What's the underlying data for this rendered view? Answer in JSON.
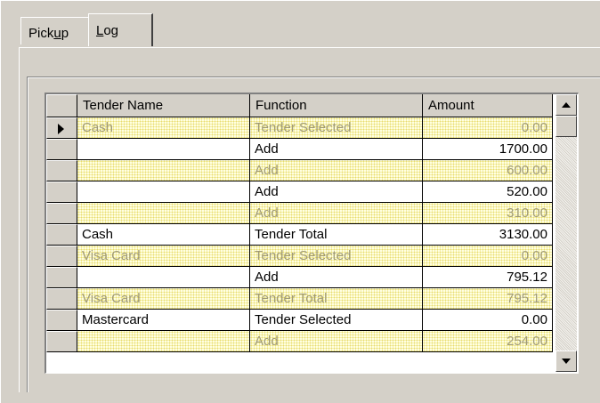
{
  "tabs": [
    {
      "label_pre": "Pick",
      "label_u": "u",
      "label_post": "p"
    },
    {
      "label_pre": "",
      "label_u": "L",
      "label_post": "og"
    }
  ],
  "grid": {
    "columns": [
      "Tender Name",
      "Function",
      "Amount"
    ],
    "rows": [
      {
        "tender": "Cash",
        "function": "Tender Selected",
        "amount": "0.00"
      },
      {
        "tender": "",
        "function": "Add",
        "amount": "1700.00"
      },
      {
        "tender": "",
        "function": "Add",
        "amount": "600.00"
      },
      {
        "tender": "",
        "function": "Add",
        "amount": "520.00"
      },
      {
        "tender": "",
        "function": "Add",
        "amount": "310.00"
      },
      {
        "tender": "Cash",
        "function": "Tender Total",
        "amount": "3130.00"
      },
      {
        "tender": "Visa Card",
        "function": "Tender Selected",
        "amount": "0.00"
      },
      {
        "tender": "",
        "function": "Add",
        "amount": "795.12"
      },
      {
        "tender": "Visa Card",
        "function": "Tender Total",
        "amount": "795.12"
      },
      {
        "tender": "Mastercard",
        "function": "Tender Selected",
        "amount": "0.00"
      },
      {
        "tender": "",
        "function": "Add",
        "amount": "254.00"
      }
    ]
  }
}
